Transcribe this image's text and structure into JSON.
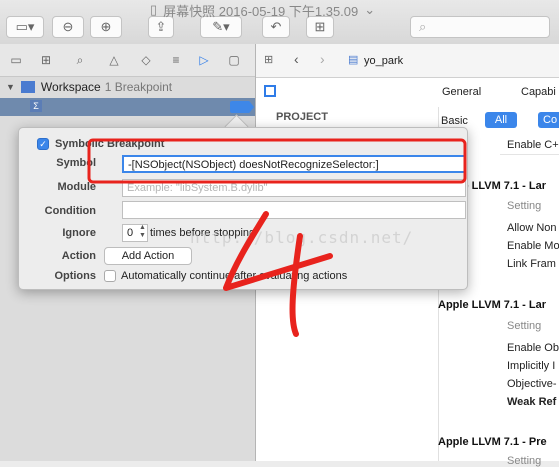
{
  "toolbar": {
    "title": "屏幕快照 2016-05-19 下午1.35.09",
    "title_sep": "-"
  },
  "navigator": {
    "workspace_label": "Workspace",
    "breakpoint_count": "1 Breakpoint",
    "tab_icons": [
      "folder-icon",
      "symbol-icon",
      "search-icon",
      "warning-icon",
      "test-icon",
      "debug-icon",
      "breakpoint-icon",
      "report-icon"
    ]
  },
  "jumpbar": {
    "file": "yo_park"
  },
  "settings": {
    "tab_general": "General",
    "tab_capabilities": "Capabi",
    "filter_basic": "Basic",
    "filter_all": "All",
    "filter_combined": "Co",
    "project_header": "PROJECT",
    "row_enable_c": "Enable C+",
    "section1": "Apple LLVM 7.1 - Lar",
    "s1_setting": "Setting",
    "s1_rows": [
      "Allow Non",
      "Enable Mo",
      "Link Fram"
    ],
    "section2": "Apple LLVM 7.1 - Lar",
    "s2_setting": "Setting",
    "s2_rows": [
      "Enable Ob",
      "Implicitly I",
      "Objective-"
    ],
    "s2_bold_row": "Weak Ref",
    "section3": "Apple LLVM 7.1 - Pre",
    "s3_setting": "Setting"
  },
  "popover": {
    "title": "Symbolic Breakpoint",
    "symbol_label": "Symbol",
    "symbol_value": "-[NSObject(NSObject) doesNotRecognizeSelector:]",
    "module_label": "Module",
    "module_placeholder": "Example: \"libSystem.B.dylib\"",
    "condition_label": "Condition",
    "ignore_label": "Ignore",
    "ignore_value": "0",
    "ignore_suffix": "times before stopping",
    "action_label": "Action",
    "add_action": "Add Action",
    "options_label": "Options",
    "options_text": "Automatically continue after evaluating actions"
  },
  "watermark": "http://blog.csdn.net/",
  "colors": {
    "annotation_red": "#e8231d",
    "accent_blue": "#3b86ea"
  }
}
